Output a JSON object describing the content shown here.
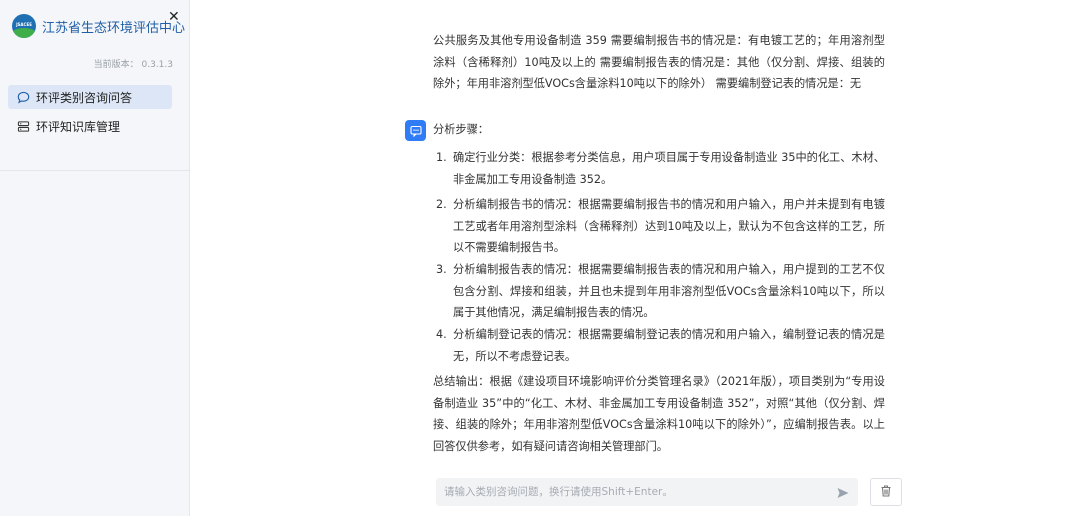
{
  "sidebar": {
    "logo_text": "JSACEE",
    "brand_name": "江苏省生态环境评估中心",
    "version_label": "当前版本：",
    "version": "0.3.1.3",
    "items": [
      {
        "label": "环评类别咨询问答",
        "icon": "chat-bubble-icon",
        "active": true
      },
      {
        "label": "环评知识库管理",
        "icon": "database-icon",
        "active": false
      }
    ]
  },
  "chat": {
    "top_message": "公共服务及其他专用设备制造 359 需要编制报告书的情况是：有电镀工艺的；年用溶剂型涂料（含稀释剂）10吨及以上的 需要编制报告表的情况是：其他（仅分割、焊接、组装的除外；年用非溶剂型低VOCs含量涂料10吨以下的除外） 需要编制登记表的情况是：无",
    "steps_title": "分析步骤：",
    "steps": [
      {
        "num": "1.",
        "text": "确定行业分类：根据参考分类信息，用户项目属于专用设备制造业 35中的化工、木材、非金属加工专用设备制造 352。"
      },
      {
        "num": "2.",
        "text": "分析编制报告书的情况：根据需要编制报告书的情况和用户输入，用户并未提到有电镀工艺或者年用溶剂型涂料（含稀释剂）达到10吨及以上，默认为不包含这样的工艺，所以不需要编制报告书。"
      },
      {
        "num": "3.",
        "text": "分析编制报告表的情况：根据需要编制报告表的情况和用户输入，用户提到的工艺不仅包含分割、焊接和组装，并且也未提到年用非溶剂型低VOCs含量涂料10吨以下，所以属于其他情况，满足编制报告表的情况。"
      },
      {
        "num": "4.",
        "text": "分析编制登记表的情况：根据需要编制登记表的情况和用户输入，编制登记表的情况是无，所以不考虑登记表。"
      }
    ],
    "summary": "总结输出：根据《建设项目环境影响评价分类管理名录》（2021年版），项目类别为“专用设备制造业 35”中的“化工、木材、非金属加工专用设备制造 352”，对照“其他（仅分割、焊接、组装的除外；年用非溶剂型低VOCs含量涂料10吨以下的除外）”，应编制报告表。以上回答仅供参考，如有疑问请咨询相关管理部门。"
  },
  "input": {
    "placeholder": "请输入类别咨询问题，换行请使用Shift+Enter。",
    "value": ""
  },
  "colors": {
    "accent": "#2f7cf6",
    "brand": "#1f5fa8",
    "sidebar_bg": "#f4f6f9",
    "active_item_bg": "#dde6f6"
  }
}
